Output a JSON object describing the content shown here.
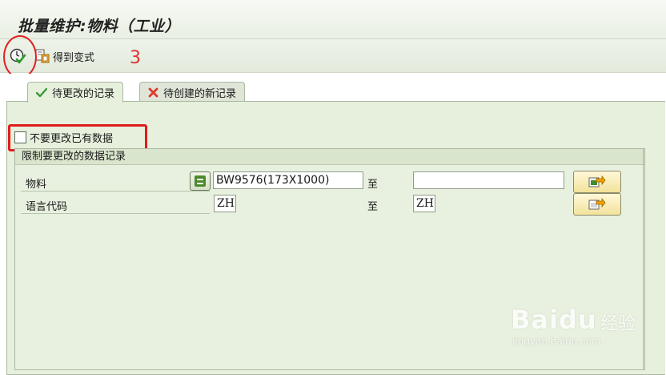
{
  "window": {
    "title": "批量维护:物料（工业）"
  },
  "toolbar": {
    "execute_icon": "execute-clock-check-icon",
    "variant_label": "得到变式",
    "variant_icon": "get-variant-icon"
  },
  "annotation": {
    "step_number": "3"
  },
  "tabs": [
    {
      "label": "待更改的记录",
      "icon": "green-check-icon",
      "active": true
    },
    {
      "label": "待创建的新记录",
      "icon": "red-x-icon",
      "active": false
    }
  ],
  "options": {
    "no_change_existing_label": "不要更改已有数据",
    "checked": false
  },
  "restrict_group": {
    "title": "限制要更改的数据记录",
    "to_label": "至",
    "rows": [
      {
        "label": "物料",
        "from_value": "BW9576(173X1000)",
        "to_value": ""
      },
      {
        "label": "语言代码",
        "from_value": "ZH",
        "to_value": "ZH"
      }
    ]
  },
  "watermark": {
    "brand": "Bai",
    "brand2": "du",
    "cn": "经验",
    "url": "jingyan.baidu.com"
  },
  "colors": {
    "accent_green": "#4d8a2c",
    "annotation_red": "#e01c1c",
    "panel_bg": "#e6f0dc"
  }
}
